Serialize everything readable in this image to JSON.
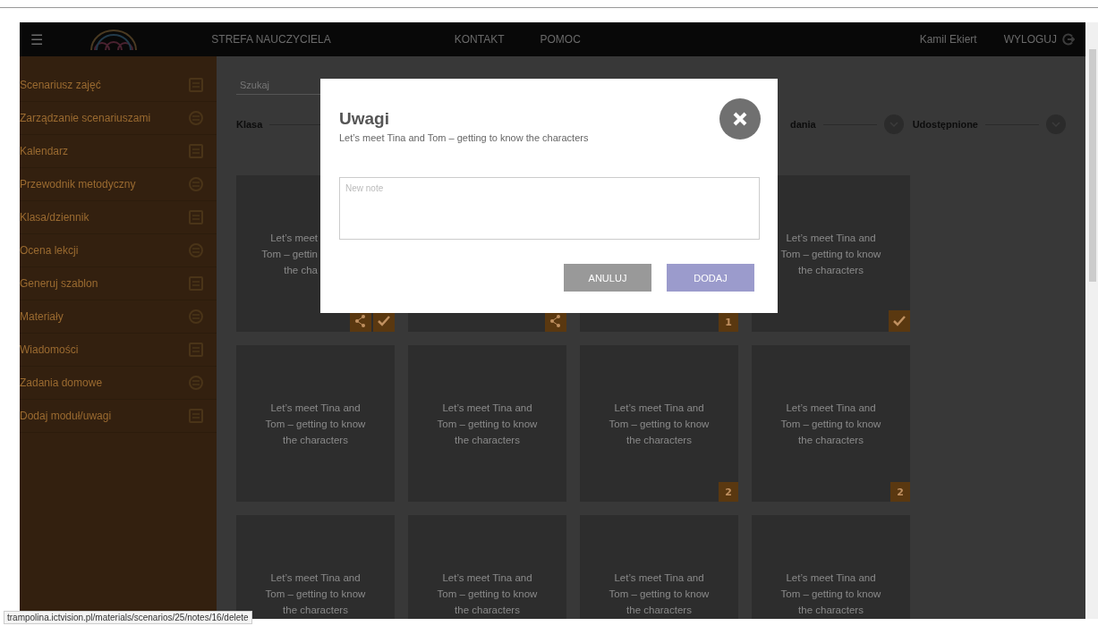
{
  "topbar": {
    "menu_icon": "☰",
    "nav": [
      "STREFA NAUCZYCIELA",
      "KONTAKT",
      "POMOC"
    ],
    "user": "Kamil Ekiert",
    "logout": "WYLOGUJ"
  },
  "sidebar": {
    "items": [
      {
        "label": "Scenariusz zajęć"
      },
      {
        "label": "Zarządzanie scenariuszami"
      },
      {
        "label": "Kalendarz"
      },
      {
        "label": "Przewodnik metodyczny"
      },
      {
        "label": "Klasa/dziennik"
      },
      {
        "label": "Ocena lekcji"
      },
      {
        "label": "Generuj szablon"
      },
      {
        "label": "Materiały"
      },
      {
        "label": "Wiadomości"
      },
      {
        "label": "Zadania domowe"
      },
      {
        "label": "Dodaj moduł/uwagi"
      }
    ]
  },
  "filters": {
    "search": {
      "placeholder": "Szukaj"
    },
    "steps": [
      {
        "label": "Klasa"
      },
      {
        "label": "dania"
      },
      {
        "label": "Udostępnione"
      }
    ]
  },
  "cards": [
    {
      "lines": [
        "Let’s meet",
        "Tom – gettin",
        "the cha"
      ],
      "covered": true,
      "badges": [
        {
          "kind": "share"
        },
        {
          "kind": "check"
        }
      ]
    },
    {
      "badges": [
        {
          "kind": "share"
        }
      ]
    },
    {
      "badges": [
        {
          "kind": "count",
          "text": "1"
        }
      ]
    },
    {
      "lines": [
        "Let’s meet Tina and",
        "Tom – getting to know",
        "the characters"
      ],
      "badges": [
        {
          "kind": "check"
        }
      ]
    },
    {
      "lines": [
        "Let’s meet Tina and",
        "Tom – getting to know",
        "the characters"
      ]
    },
    {
      "lines": [
        "Let’s meet Tina and",
        "Tom – getting to know",
        "the characters"
      ]
    },
    {
      "lines": [
        "Let’s meet Tina and",
        "Tom – getting to know",
        "the characters"
      ],
      "badges": [
        {
          "kind": "count",
          "text": "2"
        }
      ]
    },
    {
      "lines": [
        "Let’s meet Tina and",
        "Tom – getting to know",
        "the characters"
      ],
      "badges": [
        {
          "kind": "count",
          "text": "2"
        }
      ]
    },
    {
      "lines": [
        "Let’s meet Tina and",
        "Tom – getting to know",
        "the characters"
      ]
    },
    {
      "lines": [
        "Let’s meet Tina and",
        "Tom – getting to know",
        "the characters"
      ]
    },
    {
      "lines": [
        "Let’s meet Tina and",
        "Tom – getting to know",
        "the characters"
      ]
    },
    {
      "lines": [
        "Let’s meet Tina and",
        "Tom – getting to know",
        "the characters"
      ]
    }
  ],
  "modal": {
    "title": "Uwagi",
    "subtitle": "Let’s meet Tina and Tom – getting to know the characters",
    "note": {
      "placeholder": "New note"
    },
    "buttons": [
      {
        "kind": "cancel",
        "label": "ANULUJ"
      },
      {
        "kind": "primary",
        "label": "DODAJ"
      }
    ]
  },
  "status_url": "trampolina.ictvision.pl/materials/scenarios/25/notes/16/delete"
}
